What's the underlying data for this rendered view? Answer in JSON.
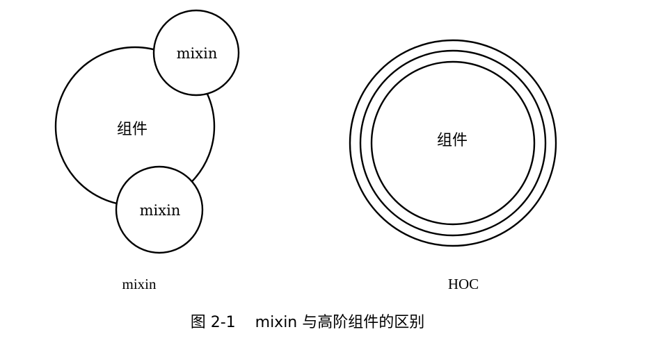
{
  "left_diagram": {
    "component_label": "组件",
    "mixin_top_label": "mixin",
    "mixin_bottom_label": "mixin",
    "caption": "mixin"
  },
  "right_diagram": {
    "component_label": "组件",
    "caption": "HOC"
  },
  "figure_caption": "图 2-1    mixin 与高阶组件的区别"
}
